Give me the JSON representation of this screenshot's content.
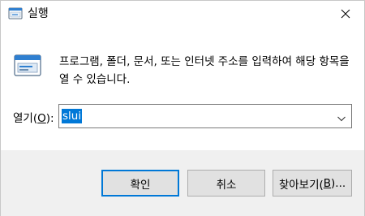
{
  "window": {
    "title": "실행",
    "title_icon": "run-dialog-icon",
    "close_icon": "close-icon"
  },
  "main": {
    "description": "프로그램, 폴더, 문서, 또는 인터넷 주소를 입력하여 해당 항목을 열 수 있습니다.",
    "icon": "run-dialog-icon",
    "open_label_prefix": "열기(",
    "open_label_mnemonic": "O",
    "open_label_suffix": "):",
    "open_value": "slui"
  },
  "buttons": {
    "ok_label": "확인",
    "cancel_label": "취소",
    "browse_prefix": "찾아보기(",
    "browse_mnemonic": "B",
    "browse_suffix": ")..."
  },
  "colors": {
    "accent": "#0078d7",
    "footer_background": "#f0f0f0",
    "button_background": "#e1e1e1"
  }
}
